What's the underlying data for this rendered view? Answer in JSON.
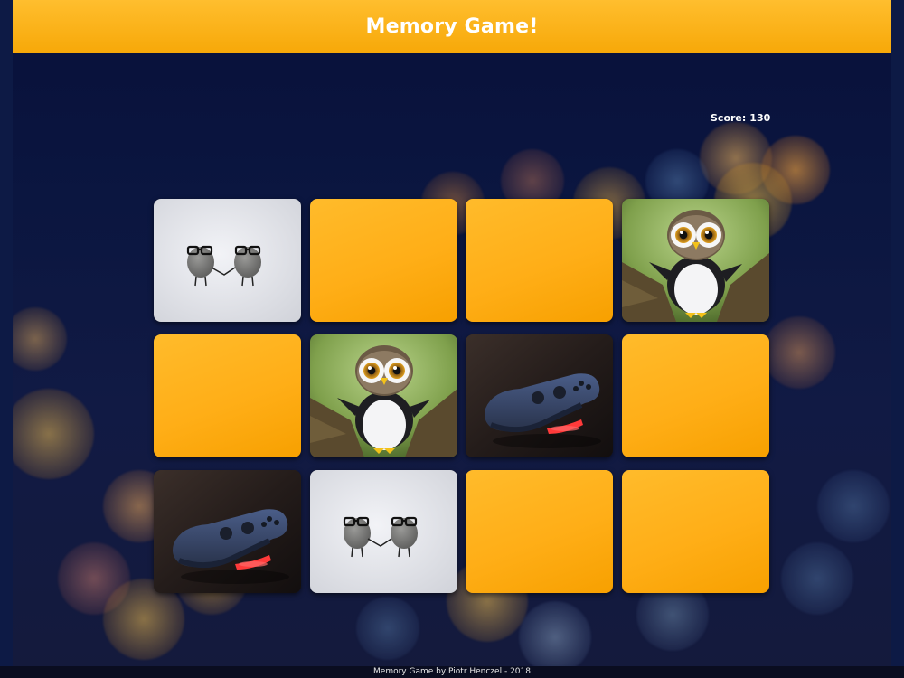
{
  "header": {
    "title": "Memory Game!"
  },
  "score": {
    "label": "Score:",
    "value": "130"
  },
  "board": {
    "cards": [
      {
        "row": 0,
        "col": 0,
        "state": "face",
        "image": "pebbles-with-glasses"
      },
      {
        "row": 0,
        "col": 1,
        "state": "back"
      },
      {
        "row": 0,
        "col": 2,
        "state": "back"
      },
      {
        "row": 0,
        "col": 3,
        "state": "face",
        "image": "owl-plush"
      },
      {
        "row": 1,
        "col": 0,
        "state": "back"
      },
      {
        "row": 1,
        "col": 1,
        "state": "face",
        "image": "owl-plush"
      },
      {
        "row": 1,
        "col": 2,
        "state": "face",
        "image": "game-controller"
      },
      {
        "row": 1,
        "col": 3,
        "state": "back"
      },
      {
        "row": 2,
        "col": 0,
        "state": "face",
        "image": "game-controller"
      },
      {
        "row": 2,
        "col": 1,
        "state": "face",
        "image": "pebbles-with-glasses"
      },
      {
        "row": 2,
        "col": 2,
        "state": "back"
      },
      {
        "row": 2,
        "col": 3,
        "state": "back"
      }
    ]
  },
  "colors": {
    "accent": "#ffb11c",
    "background": "#0b1640"
  },
  "footer": {
    "credit": "Memory Game by Piotr Henczel - 2018"
  }
}
